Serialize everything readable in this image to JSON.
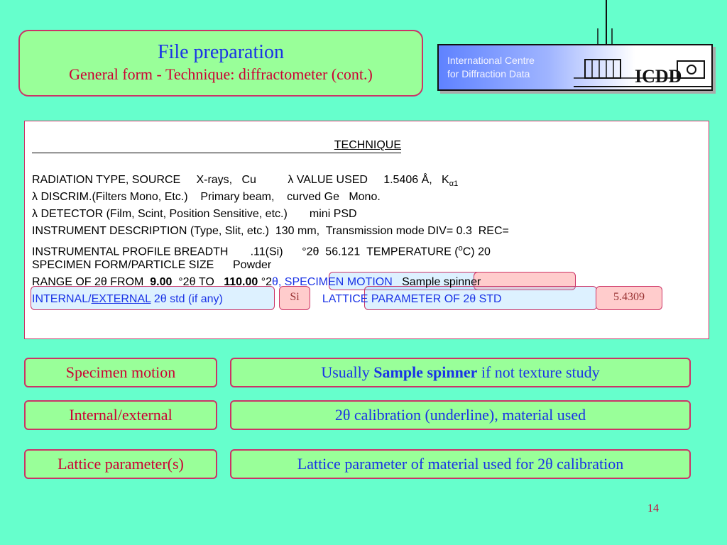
{
  "title": {
    "main": "File preparation",
    "sub": "General form - Technique: diffractometer (cont.)"
  },
  "logo": {
    "line1": "International Centre",
    "line2": "for Diffraction Data",
    "mark": "ICDD"
  },
  "form": {
    "heading": "TECHNIQUE",
    "line_radiation": "RADIATION TYPE, SOURCE     X-rays,   Cu          λ VALUE USED     1.5406 Å,   K",
    "line_radiation_sub": "α1",
    "line_discrim": "λ DISCRIM.(Filters Mono, Etc.)    Primary beam,    curved Ge   Mono.",
    "line_detector": "λ DETECTOR (Film, Scint, Position Sensitive, etc.)       mini PSD",
    "line_instrument": "INSTRUMENT DESCRIPTION (Type, Slit, etc.)  130 mm,  Transmission mode DIV= 0.3  REC=",
    "line_profile": "INSTRUMENTAL PROFILE BREADTH       .11(Si)      °2θ  56.121  TEMPERATURE (",
    "line_profile_sup": "o",
    "line_profile_end": "C) 20",
    "line_specimen": "SPECIMEN FORM/PARTICLE SIZE      Powder",
    "range_a": "RANGE OF 2θ FROM  ",
    "range_from": "9.00",
    "range_b": "  °2θ TO   ",
    "range_to": "110.00",
    "range_c": " °2",
    "range_motion": "θ, SPECIMEN MOTION",
    "range_spinner": "   Sample spinner",
    "internal_a": "INTERNAL/",
    "internal_ext": "EXTERNAL",
    "internal_b": " 2θ std (if any)",
    "internal_value": "Si",
    "lattice_label": "LATTICE PARAMETER OF 2θ STD",
    "lattice_value": "5.4309"
  },
  "rows": [
    {
      "label": "Specimen motion",
      "desc_a": "Usually ",
      "desc_b": "Sample spinner",
      "desc_c": " if not texture study"
    },
    {
      "label": "Internal/external",
      "desc": "2θ  calibration (underline), material used"
    },
    {
      "label": "Lattice parameter(s)",
      "desc": "Lattice parameter of material used for 2θ  calibration"
    }
  ],
  "page_number": "14"
}
